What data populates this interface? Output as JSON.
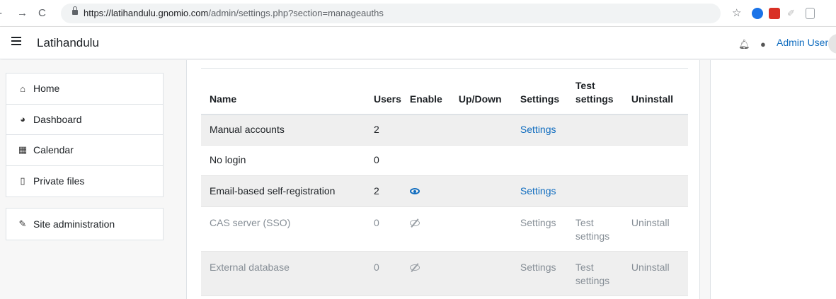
{
  "browser": {
    "url_host": "https://latihandulu.gnomio.com",
    "url_path": "/admin/settings.php?section=manageauths"
  },
  "navbar": {
    "site_name": "Latihandulu",
    "user_name": "Admin User"
  },
  "drawer": {
    "main_items": [
      {
        "label": "Home",
        "icon": "home-icon"
      },
      {
        "label": "Dashboard",
        "icon": "dashboard-icon"
      },
      {
        "label": "Calendar",
        "icon": "calendar-icon"
      },
      {
        "label": "Private files",
        "icon": "file-icon"
      }
    ],
    "admin_item": {
      "label": "Site administration",
      "icon": "wrench-icon"
    }
  },
  "table": {
    "headers": {
      "name": "Name",
      "users": "Users",
      "enable": "Enable",
      "updown": "Up/Down",
      "settings": "Settings",
      "test_line1": "Test",
      "test_line2": "settings",
      "uninstall": "Uninstall"
    },
    "rows": [
      {
        "name": "Manual accounts",
        "users": "2",
        "enable": "",
        "settings": "Settings",
        "test": "",
        "uninstall": ""
      },
      {
        "name": "No login",
        "users": "0",
        "enable": "",
        "settings": "",
        "test": "",
        "uninstall": ""
      },
      {
        "name": "Email-based self-registration",
        "users": "2",
        "enable": "eye-open-icon",
        "settings": "Settings",
        "test": "",
        "uninstall": ""
      },
      {
        "name": "CAS server (SSO)",
        "users": "0",
        "enable": "eye-slash-icon",
        "settings": "Settings",
        "test_line1": "Test",
        "test_line2": "settings",
        "uninstall": "Uninstall"
      },
      {
        "name": "External database",
        "users": "0",
        "enable": "eye-slash-icon",
        "settings": "Settings",
        "test_line1": "Test",
        "test_line2": "settings",
        "uninstall": "Uninstall"
      }
    ]
  },
  "colors": {
    "link": "#0f6cbf",
    "disabled_text": "#868e96",
    "stripe": "#efefef"
  }
}
